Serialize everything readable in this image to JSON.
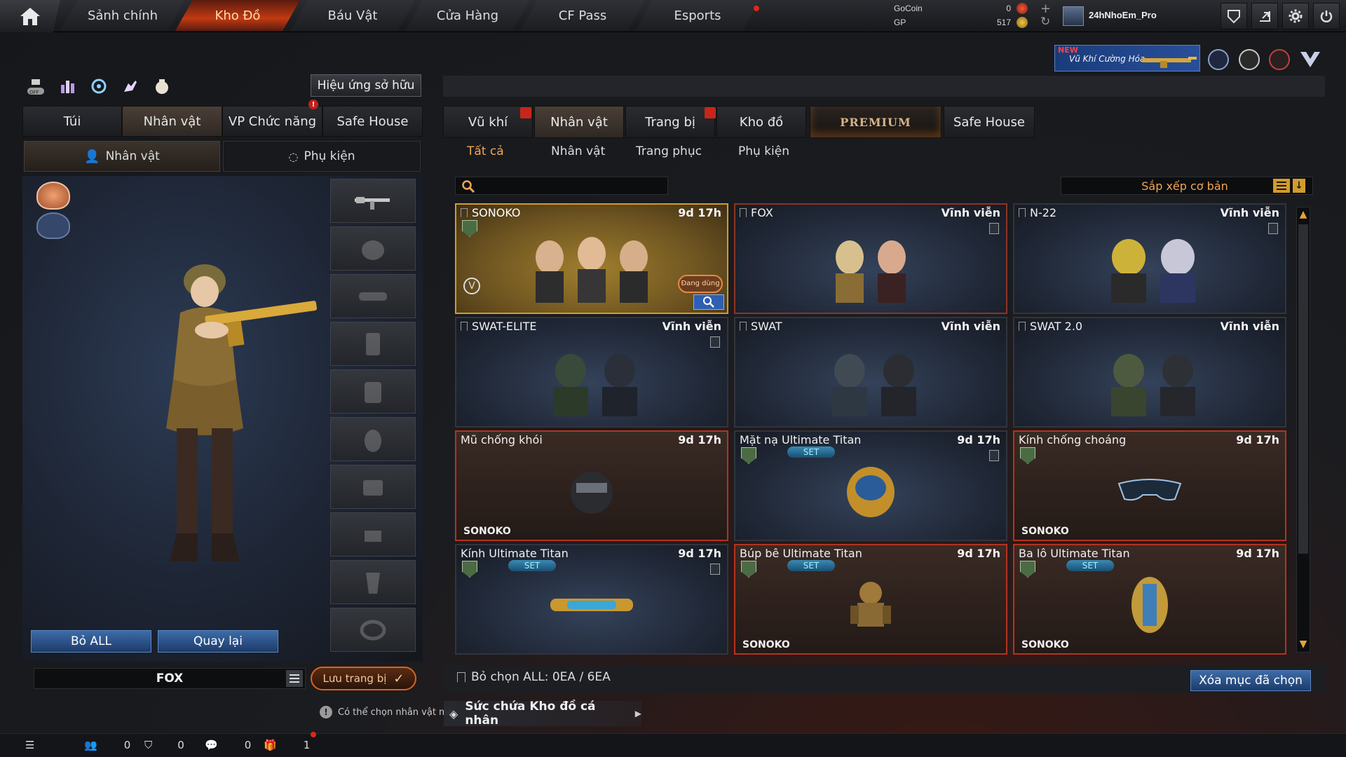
{
  "nav": {
    "tabs": [
      "Sảnh chính",
      "Kho Đồ",
      "Báu Vật",
      "Cửa Hàng",
      "CF Pass",
      "Esports"
    ],
    "active": 1
  },
  "currency": {
    "gocoin_label": "GoCoin",
    "gp_label": "GP",
    "gocoin_value": "0",
    "gp_value": "517"
  },
  "user": {
    "name": "24hNhoEm_Pro"
  },
  "promo": {
    "badge": "NEW",
    "text": "Vũ Khí Cường Hóa"
  },
  "left": {
    "effects_button": "Hiệu ứng sở hữu",
    "tabs": [
      "Túi",
      "Nhân vật",
      "VP Chức năng",
      "Safe House"
    ],
    "warn_badge": "!",
    "subtabs": [
      "Nhân vật",
      "Phụ kiện"
    ],
    "clear_all": "Bỏ ALL",
    "back": "Quay lại",
    "preset_name": "FOX",
    "save_button": "Lưu trang bị"
  },
  "right": {
    "tabs": [
      "Vũ khí",
      "Nhân vật",
      "Trang bị",
      "Kho đồ",
      "PREMIUM",
      "Safe House"
    ],
    "filters": [
      "Tất cả",
      "Nhân vật",
      "Trang phục",
      "Phụ kiện"
    ],
    "search_placeholder": "",
    "sort_label": "Sắp xếp cơ bản",
    "items": [
      {
        "name": "SONOKO",
        "time": "9d 17h",
        "style": "gold",
        "in_use": "Đang dùng"
      },
      {
        "name": "FOX",
        "time": "Vĩnh viễn",
        "style": "blue"
      },
      {
        "name": "N-22",
        "time": "Vĩnh viễn",
        "style": "blue"
      },
      {
        "name": "SWAT-ELITE",
        "time": "Vĩnh viễn",
        "style": "blue"
      },
      {
        "name": "SWAT",
        "time": "Vĩnh viễn",
        "style": "blue"
      },
      {
        "name": "SWAT 2.0",
        "time": "Vĩnh viễn",
        "style": "blue"
      },
      {
        "name": "Mũ chống khói",
        "time": "9d 17h",
        "style": "red",
        "owner": "SONOKO"
      },
      {
        "name": "Mặt nạ Ultimate Titan",
        "time": "9d 17h",
        "style": "blue",
        "set": "SET"
      },
      {
        "name": "Kính chống choáng",
        "time": "9d 17h",
        "style": "red",
        "owner": "SONOKO"
      },
      {
        "name": "Kính Ultimate Titan",
        "time": "9d 17h",
        "style": "blue",
        "set": "SET"
      },
      {
        "name": "Búp bê Ultimate Titan",
        "time": "9d 17h",
        "style": "red",
        "set": "SET",
        "owner": "SONOKO"
      },
      {
        "name": "Ba lô Ultimate Titan",
        "time": "9d 17h",
        "style": "red",
        "set": "SET",
        "owner": "SONOKO"
      }
    ],
    "deselect_label": "Bỏ chọn ALL: 0EA / 6EA",
    "delete_button": "Xóa mục đã chọn"
  },
  "footer": {
    "hint": "Có thể chọn nhân vật mà",
    "capacity": "Sức chứa Kho đồ cá nhân",
    "counts": [
      "0",
      "0",
      "0",
      "1"
    ]
  },
  "icons": {
    "home": "home-icon",
    "util": [
      "shield-icon",
      "exit-icon",
      "gear-icon",
      "power-icon"
    ],
    "toolbar": [
      "toggle-off-icon",
      "stats-icon",
      "refresh-icon",
      "hand-icon",
      "bag-icon"
    ]
  }
}
